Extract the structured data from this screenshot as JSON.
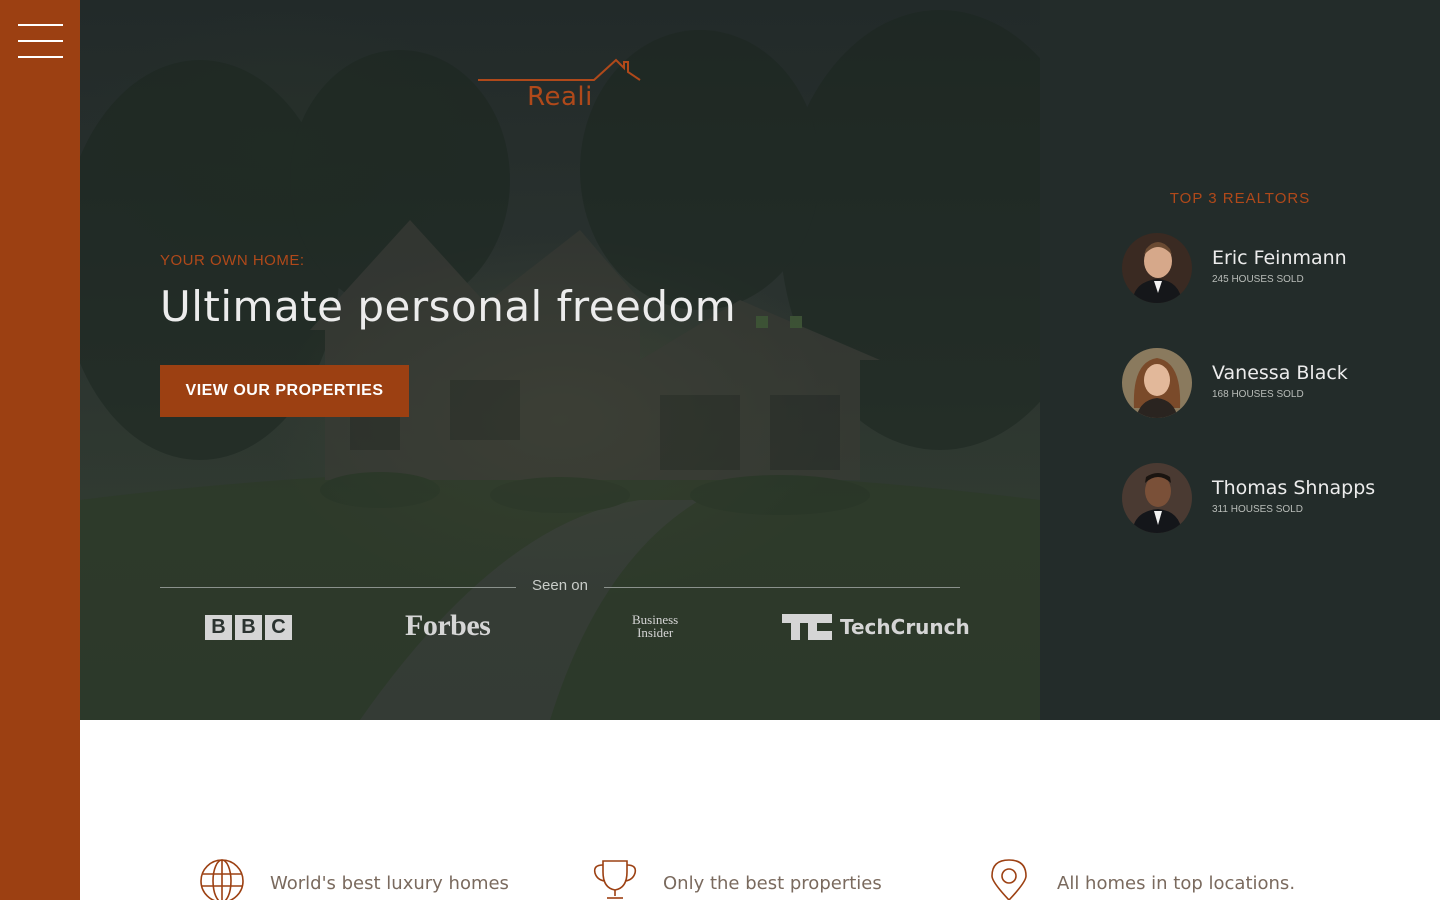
{
  "colors": {
    "accent": "#9c4012",
    "accent_text": "#b0491a",
    "hero_bg": "#2a322f",
    "panel_bg": "#232c2a",
    "light_text": "#ececec"
  },
  "nav": {
    "menu_icon": "hamburger-menu-icon"
  },
  "logo": {
    "text": "Reali",
    "icon": "house-roof-icon"
  },
  "hero": {
    "eyebrow": "YOUR OWN HOME:",
    "headline": "Ultimate personal freedom",
    "cta_label": "VIEW OUR PROPERTIES",
    "background_image": "house-photo"
  },
  "press": {
    "label": "Seen on",
    "logos": [
      {
        "name": "BBC",
        "letters": [
          "B",
          "B",
          "C"
        ]
      },
      {
        "name": "Forbes"
      },
      {
        "name": "Business Insider",
        "line1": "Business",
        "line2": "Insider"
      },
      {
        "name": "TechCrunch",
        "mark": "TC",
        "text": "TechCrunch"
      }
    ]
  },
  "realtors": {
    "title": "TOP 3 REALTORS",
    "items": [
      {
        "name": "Eric Feinmann",
        "sold": "245 HOUSES SOLD",
        "avatar": "eric-avatar"
      },
      {
        "name": "Vanessa Black",
        "sold": "168 HOUSES SOLD",
        "avatar": "vanessa-avatar"
      },
      {
        "name": "Thomas Shnapps",
        "sold": "311 HOUSES SOLD",
        "avatar": "thomas-avatar"
      }
    ]
  },
  "features": [
    {
      "label": "World's best luxury homes",
      "icon": "globe-icon"
    },
    {
      "label": "Only the best properties",
      "icon": "trophy-icon"
    },
    {
      "label": "All homes in top locations.",
      "icon": "map-pin-icon"
    }
  ]
}
